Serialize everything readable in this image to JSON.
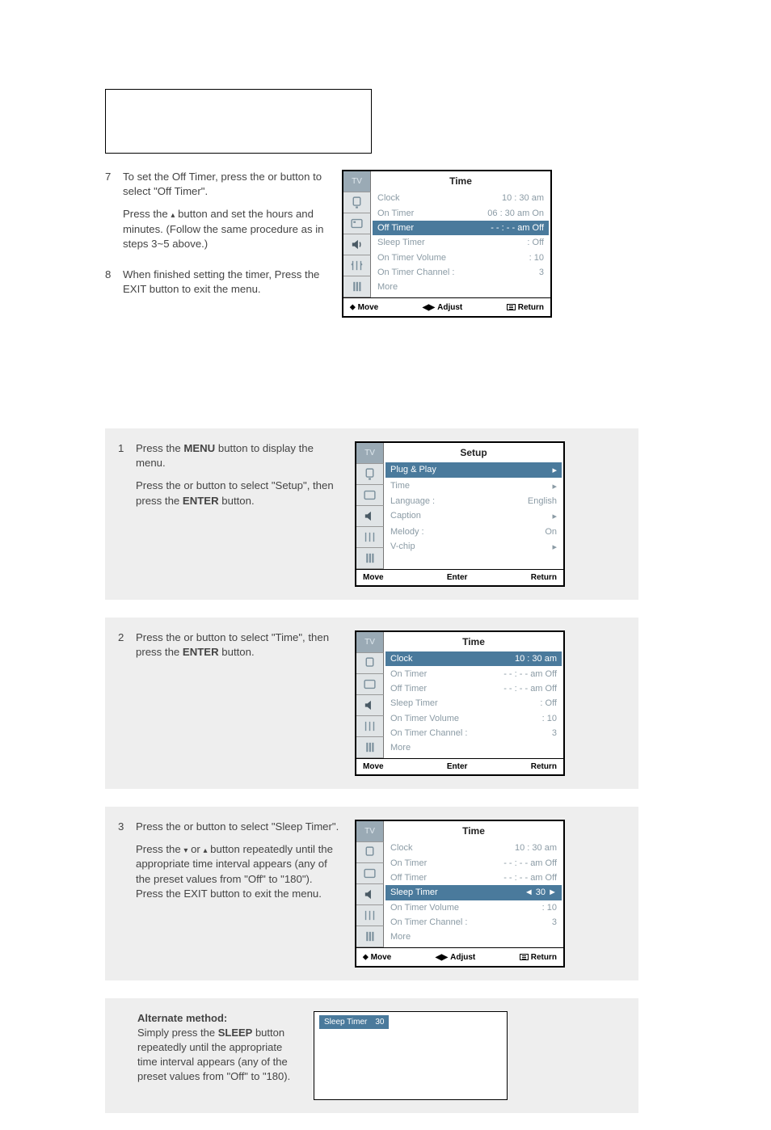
{
  "section1": {
    "step7": {
      "num": "7",
      "text_a": "To set the Off Timer, press the ",
      "text_b": " or ",
      "text_c": " button to select \"Off Timer\".",
      "text_d": "Press the ",
      "text_e": " button and set the hours and minutes. (Follow the same procedure as in steps 3~5 above.)"
    },
    "step8": {
      "num": "8",
      "text": "When finished setting the timer, Press the EXIT button to exit the menu."
    },
    "osd": {
      "title": "Time",
      "tabs": [
        "TV",
        "",
        "",
        "",
        "",
        ""
      ],
      "rows": [
        {
          "label": "Clock",
          "value": "10 : 30 am",
          "hl": false
        },
        {
          "label": "On Timer",
          "value": "06 : 30 am On",
          "hl": false
        },
        {
          "label": "Off Timer",
          "value": "- - : - - am Off",
          "hl": true
        },
        {
          "label": "Sleep Timer",
          "value": ": Off",
          "hl": false
        },
        {
          "label": "On Timer Volume",
          "value": ": 10",
          "hl": false
        },
        {
          "label": "On Timer Channel :",
          "value": "3",
          "hl": false
        },
        {
          "label": "   More",
          "value": "",
          "hl": false
        }
      ],
      "bottom": {
        "move": "Move",
        "center": "Adjust",
        "right": "Return"
      }
    }
  },
  "section2": {
    "step1": {
      "num": "1",
      "text_a": "Press the ",
      "menu_bold": "MENU",
      "text_b": " button to display the menu.",
      "text_c": "Press the ",
      "text_d": " or ",
      "text_e": " button to select \"Setup\", then press the ",
      "enter_bold": "ENTER",
      "text_f": " button."
    },
    "osd1": {
      "title": "Setup",
      "rows": [
        {
          "label": "Plug & Play",
          "value": "▸",
          "hl": true
        },
        {
          "label": "Time",
          "value": "▸",
          "hl": false
        },
        {
          "label": "Language :",
          "value": "English",
          "hl": false
        },
        {
          "label": "Caption",
          "value": "▸",
          "hl": false
        },
        {
          "label": "Melody    :",
          "value": "On",
          "hl": false
        },
        {
          "label": "V-chip",
          "value": "▸",
          "hl": false
        }
      ],
      "bottom": {
        "move": "Move",
        "center": "Enter",
        "right": "Return"
      }
    },
    "step2": {
      "num": "2",
      "text_a": "Press the ",
      "text_b": " or ",
      "text_c": " button to select \"Time\", then press the ",
      "enter_bold": "ENTER",
      "text_d": " button."
    },
    "osd2": {
      "title": "Time",
      "rows": [
        {
          "label": "Clock",
          "value": "10 : 30 am",
          "hl": true
        },
        {
          "label": "On Timer",
          "value": "- - : - - am Off",
          "hl": false
        },
        {
          "label": "Off Timer",
          "value": "- - : - - am Off",
          "hl": false
        },
        {
          "label": "Sleep Timer",
          "value": ": Off",
          "hl": false
        },
        {
          "label": "On Timer Volume",
          "value": ": 10",
          "hl": false
        },
        {
          "label": "On Timer Channel :",
          "value": "3",
          "hl": false
        },
        {
          "label": "   More",
          "value": "",
          "hl": false
        }
      ],
      "bottom": {
        "move": "Move",
        "center": "Enter",
        "right": "Return"
      }
    },
    "step3": {
      "num": "3",
      "text_a": "Press the ",
      "text_b": " or ",
      "text_c": " button to select \"Sleep Timer\".",
      "text_d": "Press the ",
      "text_e": " or ",
      "text_f": " button repeatedly until the appropriate time interval appears (any of the preset values from \"Off\" to \"180\"). Press the EXIT button to exit the menu."
    },
    "osd3": {
      "title": "Time",
      "rows": [
        {
          "label": "Clock",
          "value": "10 : 30 am",
          "hl": false
        },
        {
          "label": "On Timer",
          "value": "- - : - - am Off",
          "hl": false
        },
        {
          "label": "Off Timer",
          "value": "- - : - - am Off",
          "hl": false
        },
        {
          "label": "Sleep Timer",
          "value": "30",
          "hl": true,
          "sel": true
        },
        {
          "label": "On Timer Volume",
          "value": ": 10",
          "hl": false
        },
        {
          "label": "On Timer Channel :",
          "value": "3",
          "hl": false
        },
        {
          "label": "   More",
          "value": "",
          "hl": false
        }
      ],
      "bottom": {
        "move": "Move",
        "center": "Adjust",
        "right": "Return"
      }
    },
    "alt": {
      "heading": "Alternate method:",
      "text_a": "Simply press the ",
      "sleep_bold": "SLEEP",
      "text_b": " button repeatedly until the appropriate time interval appears (any of the preset values from \"Off\" to \"180).",
      "banner_label": "Sleep Timer",
      "banner_value": "30"
    }
  },
  "icons": {
    "tv": "TV"
  }
}
